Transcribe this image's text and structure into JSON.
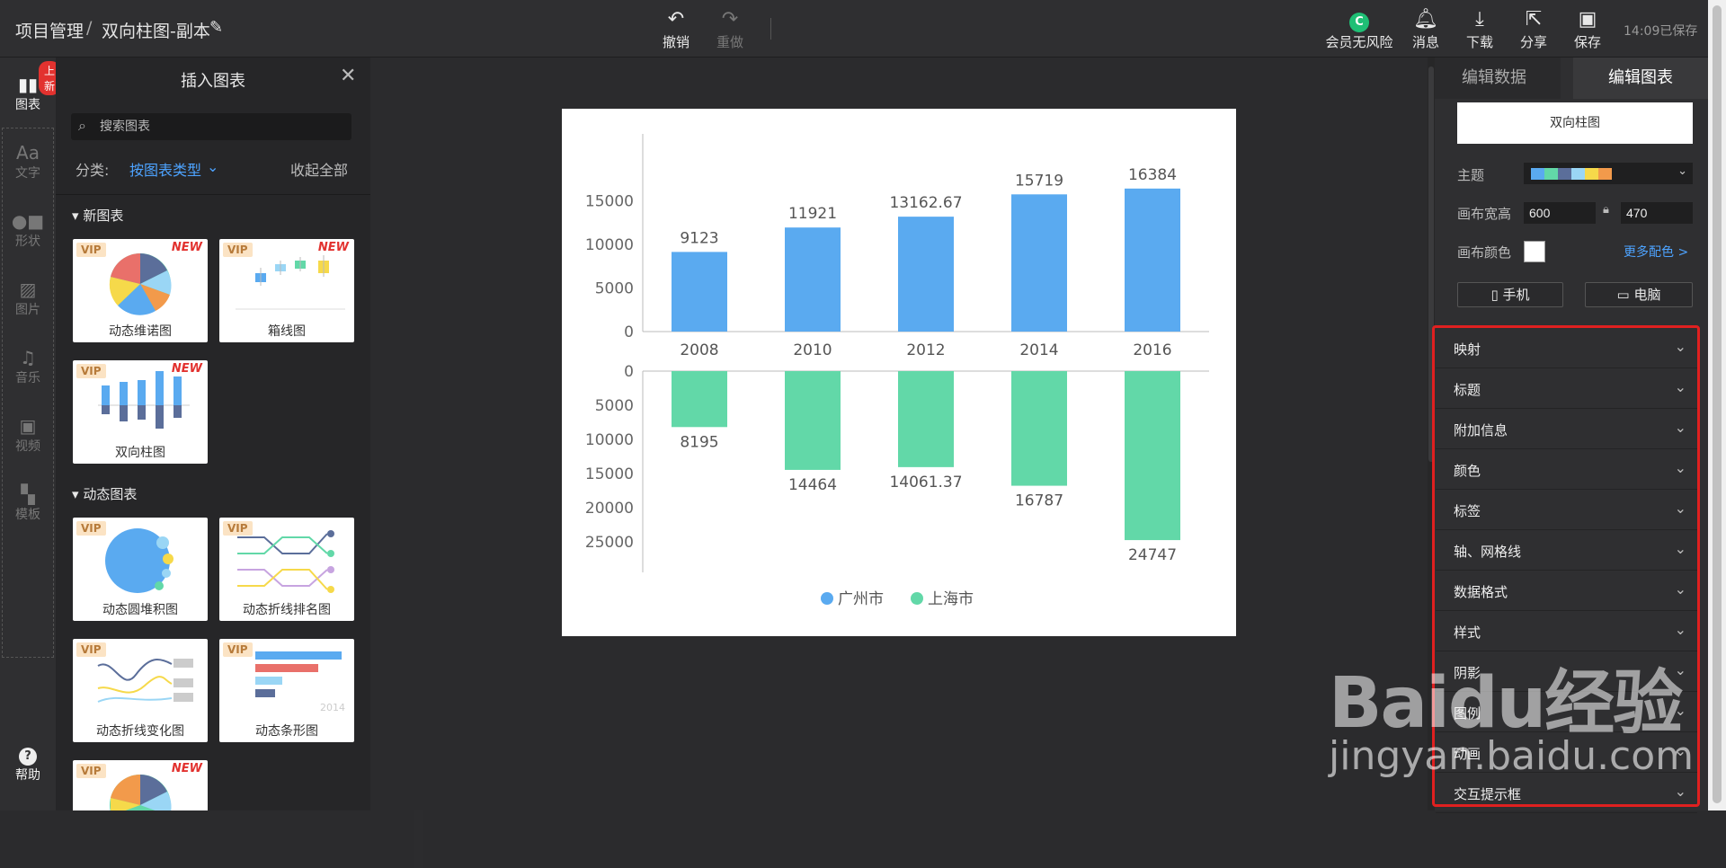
{
  "header": {
    "breadcrumb_root": "项目管理",
    "breadcrumb_sep": "/",
    "doc_title": "双向柱图-副本",
    "undo": "撤销",
    "redo": "重做",
    "vip_safe": "会员无风险",
    "messages": "消息",
    "download": "下载",
    "share": "分享",
    "save": "保存",
    "saved_status": "14:09已保存"
  },
  "rail": {
    "badge": "上新",
    "items": [
      "图表",
      "文字",
      "形状",
      "图片",
      "音乐",
      "视频",
      "模板"
    ],
    "help": "帮助"
  },
  "panel": {
    "title": "插入图表",
    "search_placeholder": "搜索图表",
    "filter_label": "分类:",
    "filter_value": "按图表类型",
    "collapse_all": "收起全部",
    "sections": [
      "新图表",
      "动态图表"
    ],
    "vip": "VIP",
    "new": "NEW",
    "cards": [
      {
        "label": "动态维诺图"
      },
      {
        "label": "箱线图"
      },
      {
        "label": "双向柱图"
      },
      {
        "label": "动态圆堆积图"
      },
      {
        "label": "动态折线排名图"
      },
      {
        "label": "动态折线变化图"
      },
      {
        "label": "动态条形图"
      },
      {
        "label": ""
      }
    ],
    "card_year": "2014"
  },
  "chart_data": {
    "type": "bar",
    "categories": [
      "2008",
      "2010",
      "2012",
      "2014",
      "2016"
    ],
    "series": [
      {
        "name": "广州市",
        "values": [
          9123,
          11921,
          13162.67,
          15719,
          16384
        ],
        "color": "#5aaaf0",
        "labels": [
          "9123",
          "11921",
          "13162.67",
          "15719",
          "16384"
        ]
      },
      {
        "name": "上海市",
        "values": [
          8195,
          14464,
          14061.37,
          16787,
          24747
        ],
        "color": "#62d8a8",
        "labels": [
          "8195",
          "14464",
          "14061.37",
          "16787",
          "24747"
        ]
      }
    ],
    "top_axis": {
      "ticks": [
        0,
        5000,
        10000,
        15000
      ],
      "tick_labels": [
        "0",
        "5000",
        "10000",
        "15000"
      ],
      "max": 17500
    },
    "bottom_axis": {
      "ticks": [
        0,
        5000,
        10000,
        15000,
        20000,
        25000
      ],
      "tick_labels": [
        "0",
        "5000",
        "10000",
        "15000",
        "20000",
        "25000"
      ],
      "max": 30000
    },
    "legend_position": "bottom-center"
  },
  "right": {
    "tab_data": "编辑数据",
    "tab_chart": "编辑图表",
    "chart_name": "双向柱图",
    "theme_label": "主题",
    "theme_colors": [
      "#5aaaf0",
      "#62d8a8",
      "#5b6e9a",
      "#9ad6f5",
      "#f6d94a",
      "#f29a4b"
    ],
    "canvas_size_label": "画布宽高",
    "width": "600",
    "height": "470",
    "canvas_color_label": "画布颜色",
    "canvas_color": "#ffffff",
    "more_colors": "更多配色 >",
    "phone": "手机",
    "pc": "电脑",
    "sections": [
      "映射",
      "标题",
      "附加信息",
      "颜色",
      "标签",
      "轴、网格线",
      "数据格式",
      "样式",
      "阴影",
      "图例",
      "动画",
      "交互提示框"
    ]
  },
  "watermark": {
    "big": "Baidu经验",
    "small": "jingyan.baidu.com"
  }
}
